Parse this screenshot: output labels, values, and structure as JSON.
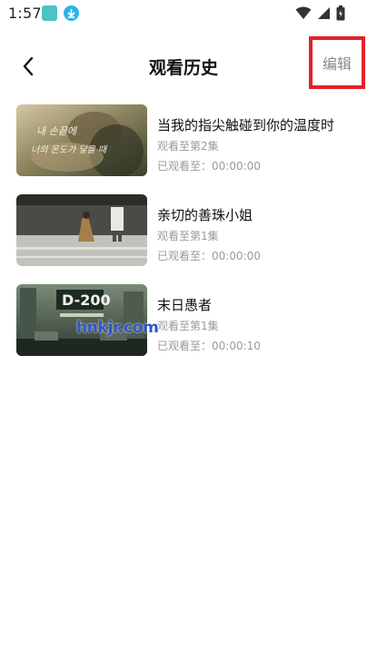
{
  "status_bar": {
    "time": "1:57"
  },
  "header": {
    "title": "观看历史",
    "edit_label": "编辑"
  },
  "history": [
    {
      "title": "当我的指尖触碰到你的温度时",
      "episode": "观看至第2集",
      "progress": "已观看至：00:00:00",
      "thumb_text_1": "내 손끝에",
      "thumb_text_2": "너의 온도가 닿을 때"
    },
    {
      "title": "亲切的善珠小姐",
      "episode": "观看至第1集",
      "progress": "已观看至：00:00:00"
    },
    {
      "title": "末日愚者",
      "episode": "观看至第1集",
      "progress": "已观看至：00:00:10",
      "thumb_text_1": "D-200"
    }
  ],
  "watermark": "hnkjr.com"
}
